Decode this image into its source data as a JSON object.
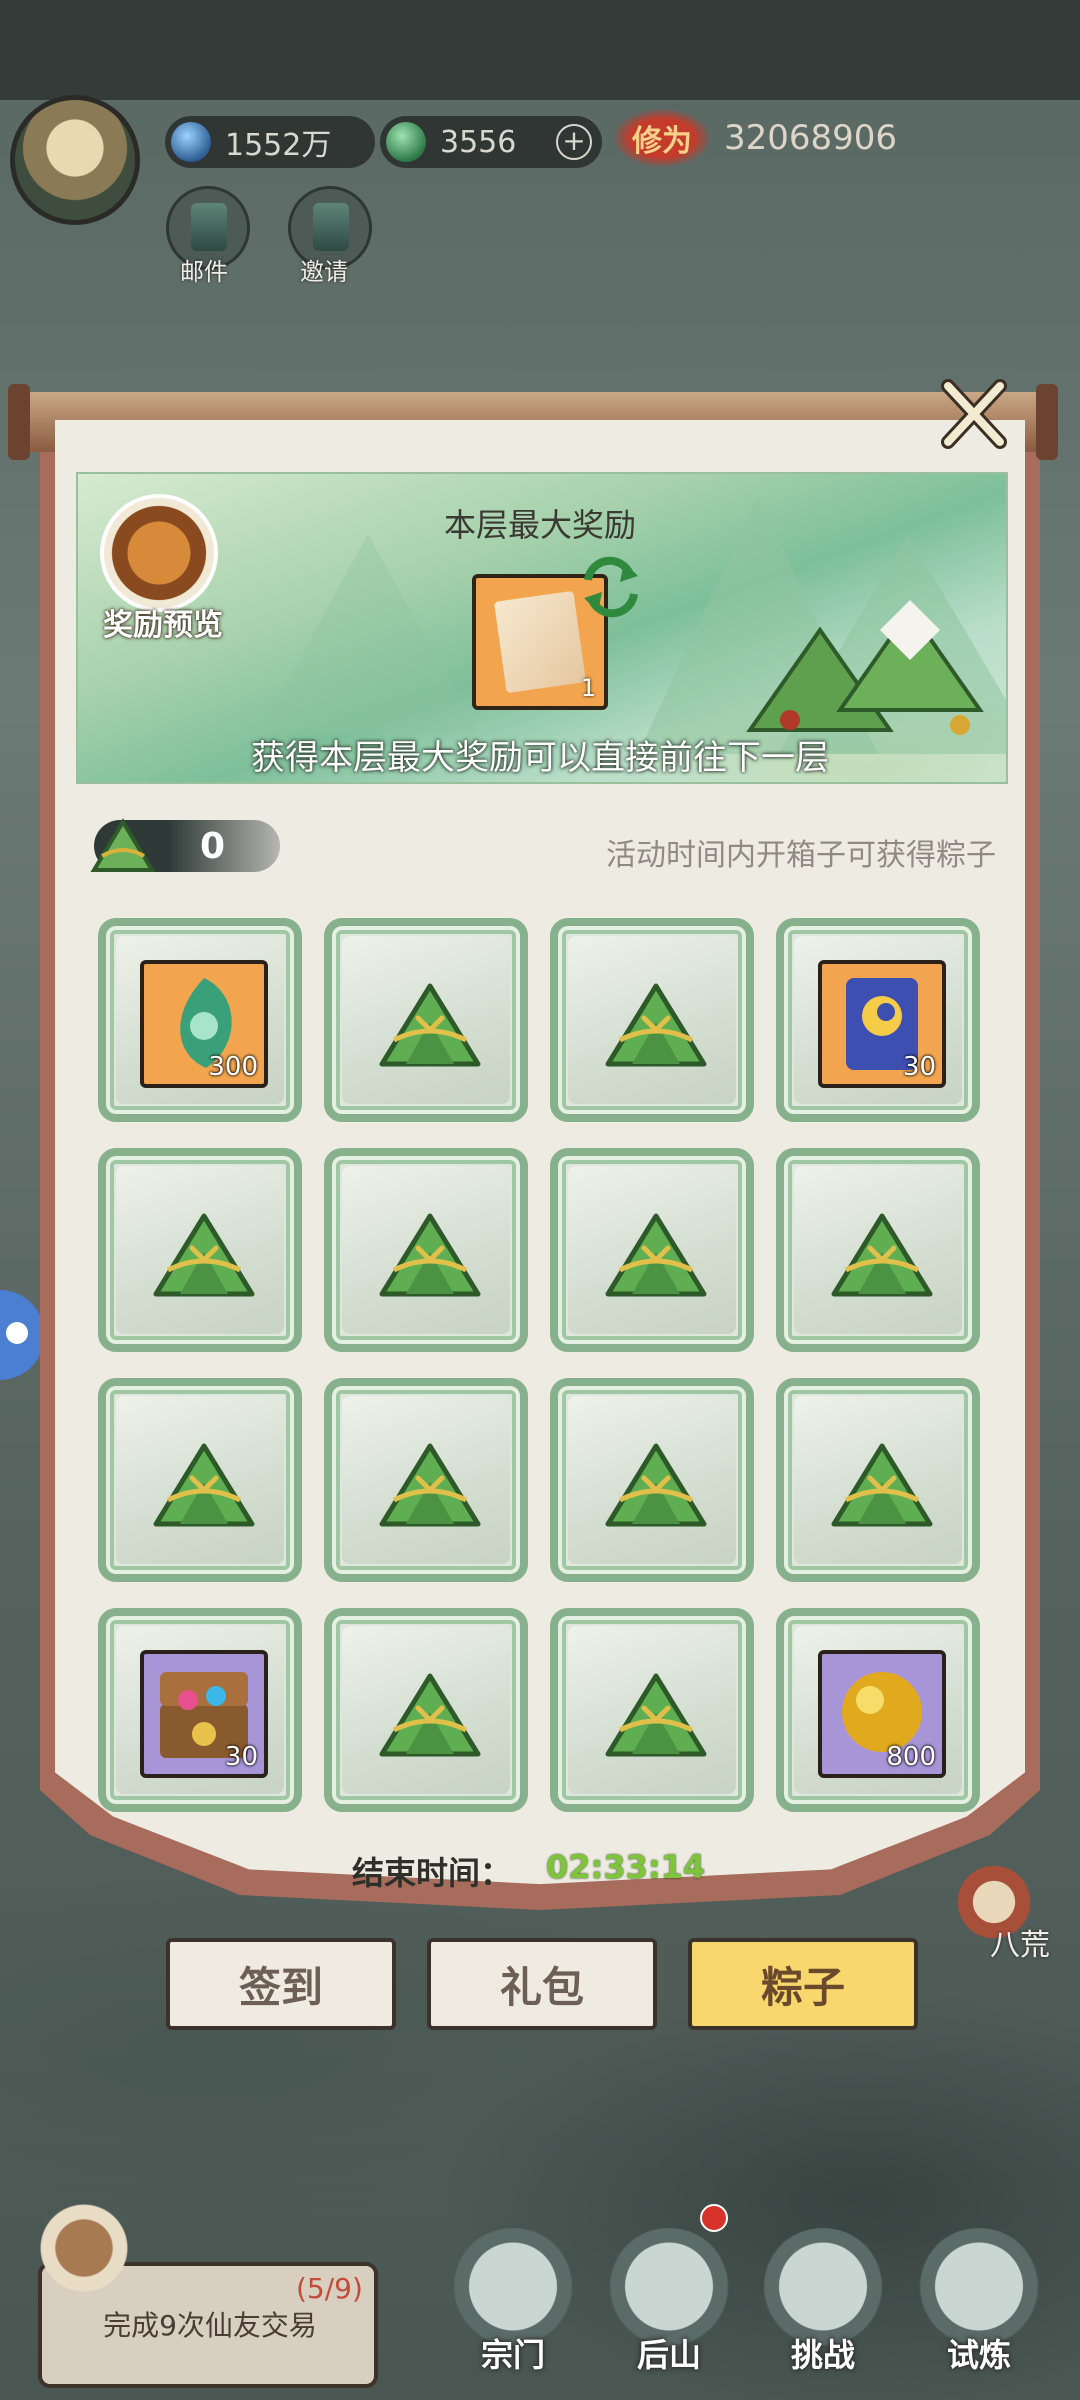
{
  "hud": {
    "currency1": "1552万",
    "currency2": "3556",
    "xiuwei_label": "修为",
    "xiuwei_value": "32068906",
    "mail_label": "邮件",
    "invite_label": "邀请"
  },
  "banner": {
    "preview_label": "奖励预览",
    "max_reward_title": "本层最大奖励",
    "max_reward_count": "1",
    "tip": "获得本层最大奖励可以直接前往下一层"
  },
  "counter": {
    "value": "0",
    "tip": "活动时间内开箱子可获得粽子"
  },
  "grid": {
    "cells": [
      {
        "type": "item",
        "icon": "jade-icon",
        "count": "300",
        "bg": "#f2a54e"
      },
      {
        "type": "zongzi"
      },
      {
        "type": "zongzi"
      },
      {
        "type": "item",
        "icon": "scroll-token-icon",
        "count": "30",
        "bg": "#f2a54e"
      },
      {
        "type": "zongzi"
      },
      {
        "type": "zongzi"
      },
      {
        "type": "zongzi"
      },
      {
        "type": "zongzi"
      },
      {
        "type": "zongzi"
      },
      {
        "type": "zongzi"
      },
      {
        "type": "zongzi"
      },
      {
        "type": "zongzi"
      },
      {
        "type": "item",
        "icon": "treasure-chest-icon",
        "count": "30",
        "bg": "#a895d8"
      },
      {
        "type": "zongzi"
      },
      {
        "type": "zongzi"
      },
      {
        "type": "item",
        "icon": "gold-orb-icon",
        "count": "800",
        "bg": "#a895d8"
      }
    ]
  },
  "end_time": {
    "label": "结束时间：",
    "value": "02:33:14"
  },
  "tabs": {
    "signin": "签到",
    "gift": "礼包",
    "zongzi": "粽子"
  },
  "side": {
    "bahuang": "八荒"
  },
  "quest": {
    "progress": "(5/9)",
    "text": "完成9次仙友交易"
  },
  "nav": {
    "sect": "宗门",
    "backhill": "后山",
    "challenge": "挑战",
    "trial": "试炼"
  }
}
